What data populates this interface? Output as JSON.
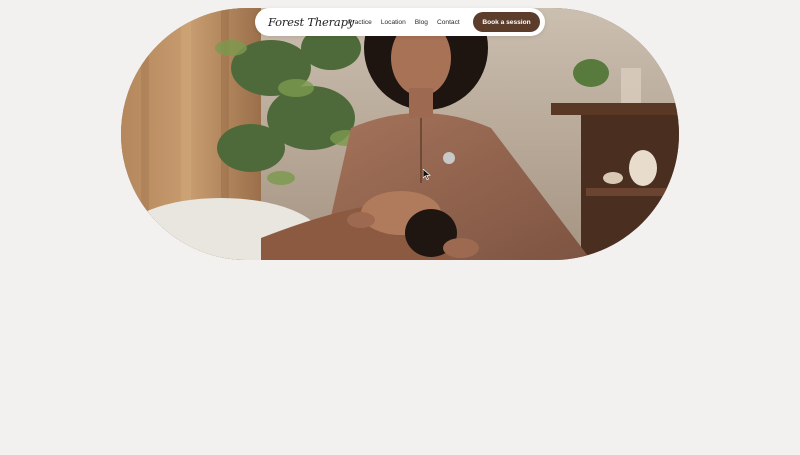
{
  "brand": {
    "logo_text": "Forest Therapy"
  },
  "nav": {
    "links": [
      {
        "label": "Practice"
      },
      {
        "label": "Location"
      },
      {
        "label": "Blog"
      },
      {
        "label": "Contact"
      }
    ],
    "cta_label": "Book a session"
  },
  "hero": {
    "image_subject": "massage therapist with curly hair in a brown linen top holding the head of a woman lying on a massage table, green plants and wooden shelf in background"
  },
  "colors": {
    "page_background": "#f3f1ef",
    "cta_background": "#5c3d2c",
    "navbar_background": "#ffffff"
  }
}
